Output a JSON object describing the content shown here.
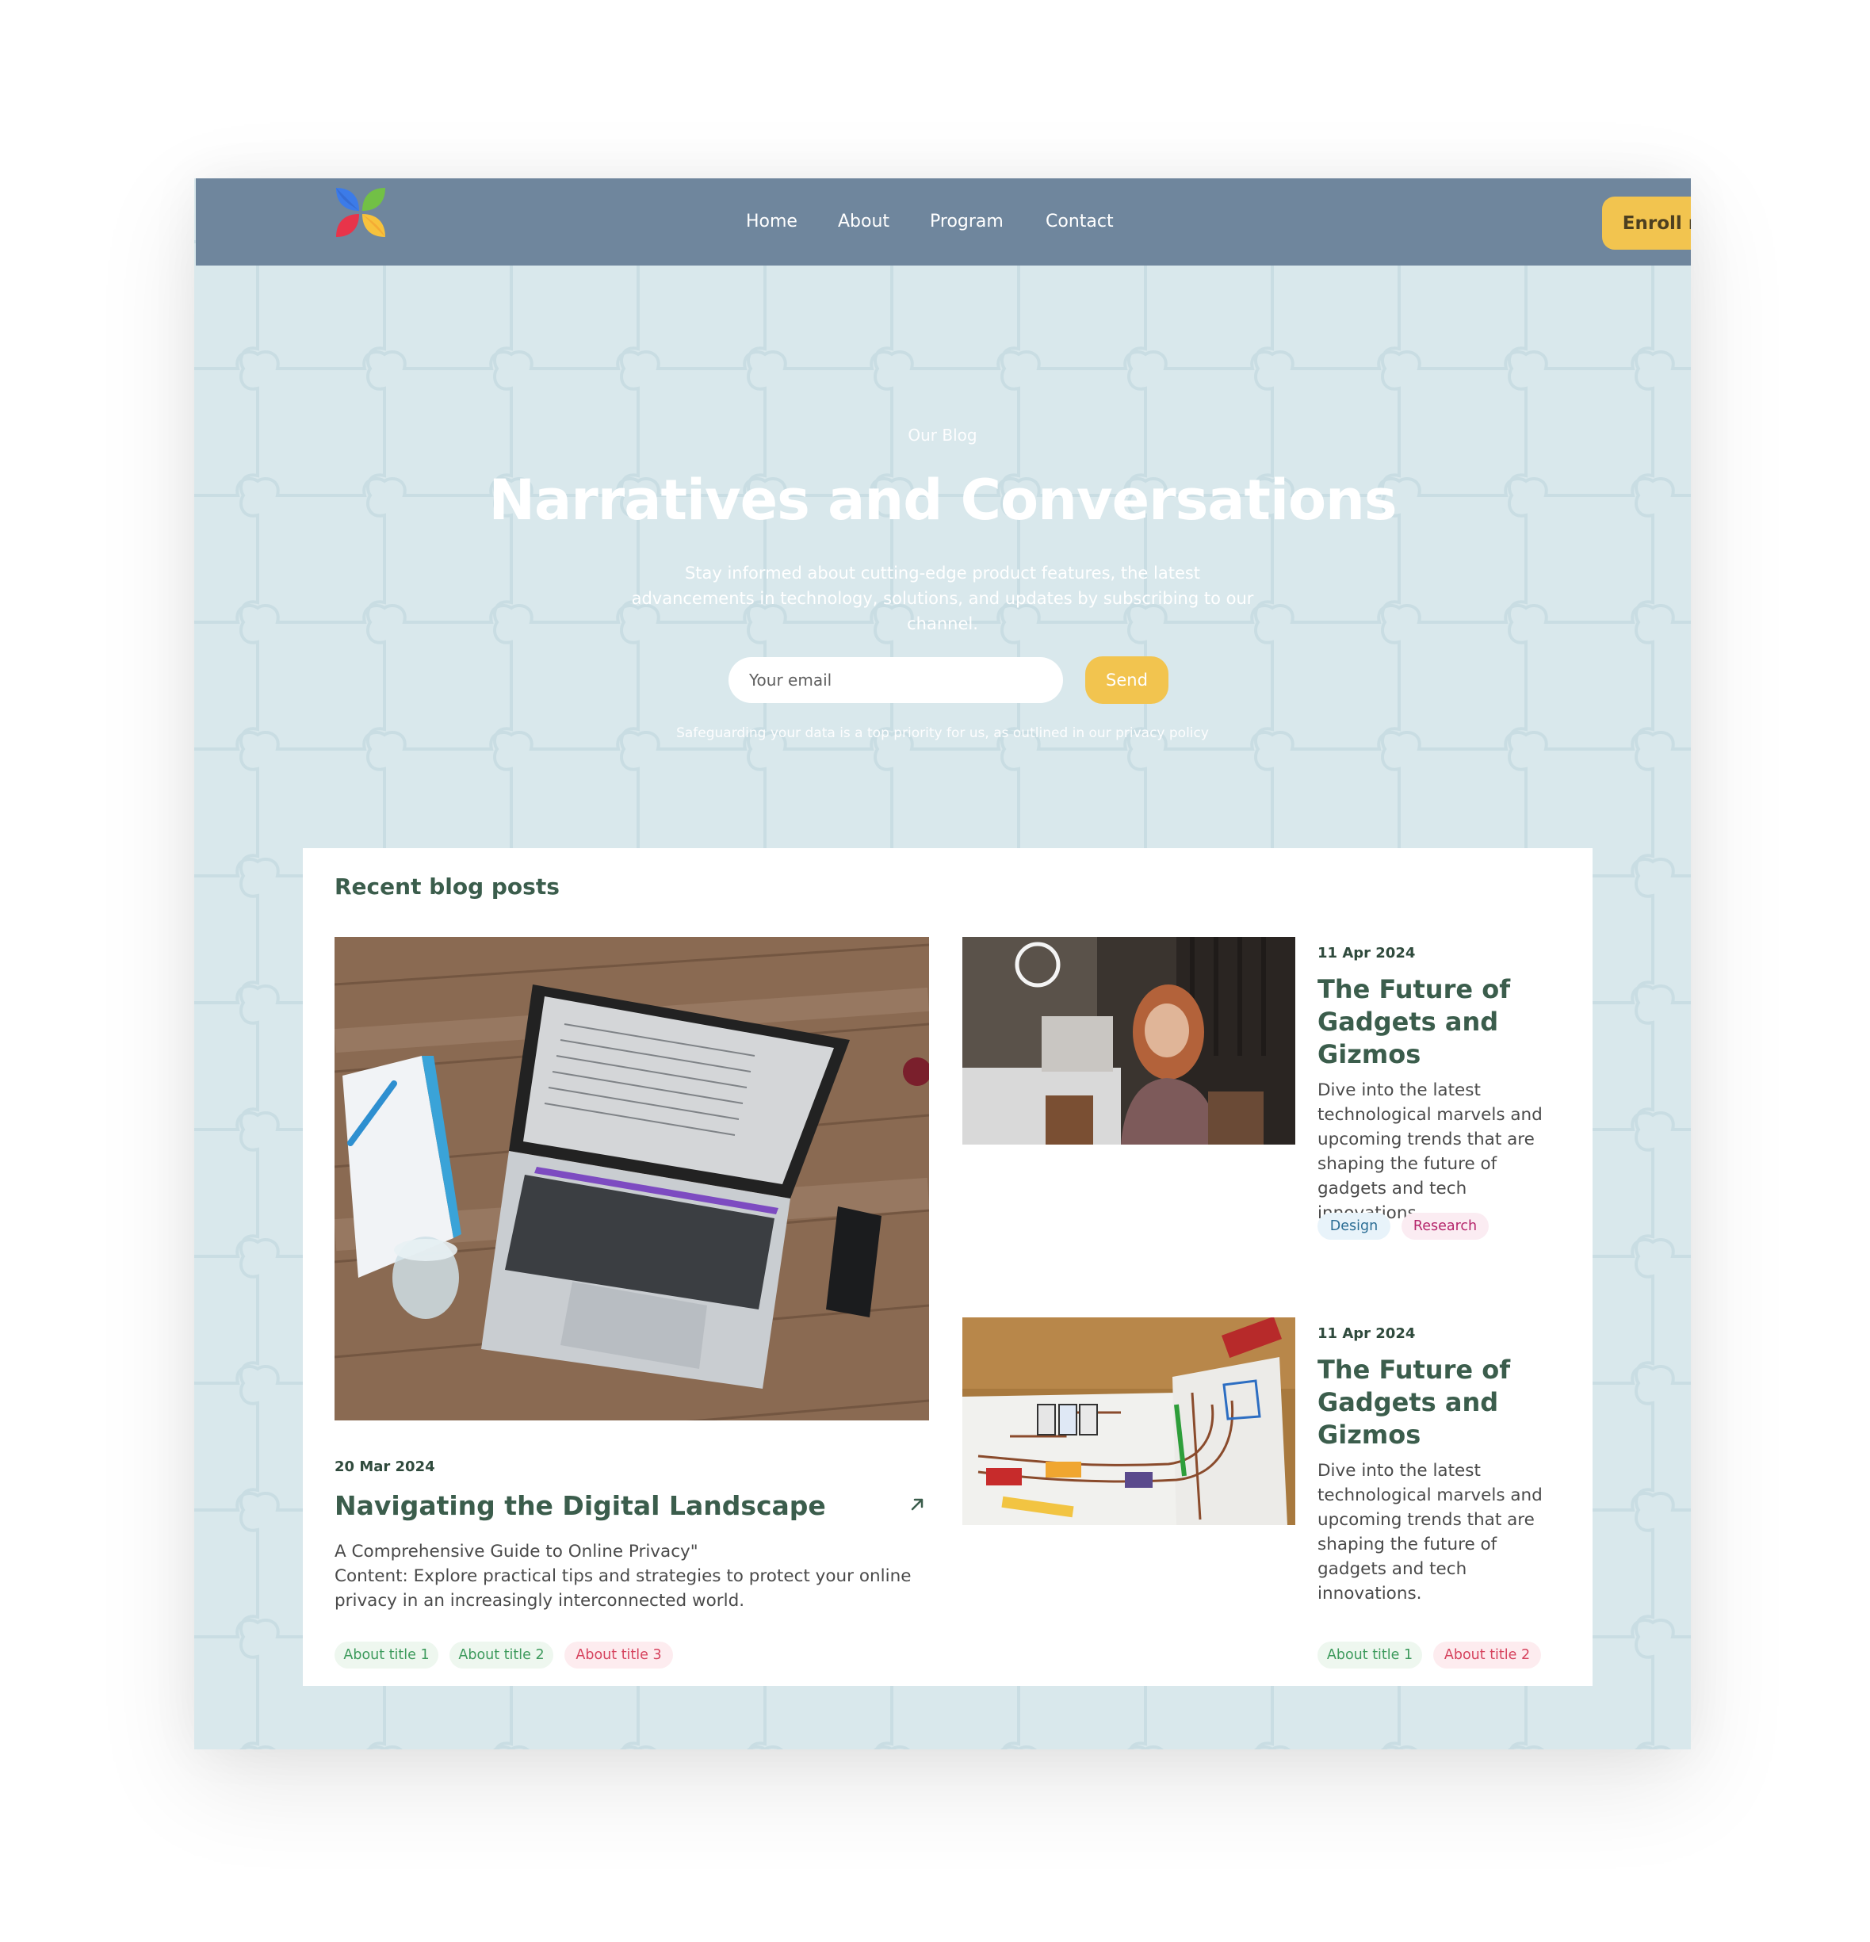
{
  "nav": {
    "links": [
      "Home",
      "About",
      "Program",
      "Contact"
    ],
    "enroll_label": "Enroll now"
  },
  "hero": {
    "kicker": "Our Blog",
    "title": "Narratives and Conversations",
    "subtitle": "Stay informed about cutting-edge product features, the latest advancements in technology, solutions, and updates by subscribing to our channel.",
    "email_placeholder": "Your email",
    "send_label": "Send",
    "privacy": "Safeguarding your data is a top priority for us, as outlined in our privacy policy"
  },
  "blog": {
    "section_title": "Recent blog posts",
    "featured": {
      "date": "20 Mar 2024",
      "title": "Navigating the Digital Landscape",
      "desc_line1": "A Comprehensive Guide to Online Privacy\"",
      "desc_line2": "Content: Explore practical tips and strategies to protect your online privacy in an increasingly interconnected world.",
      "tags": [
        "About title 1",
        "About title 2",
        "About title 3"
      ]
    },
    "posts": [
      {
        "date": "11 Apr 2024",
        "title": "The Future of Gadgets and Gizmos",
        "desc": "Dive into the latest technological marvels and upcoming trends that are shaping the future of gadgets and tech innovations.",
        "tags": [
          "Design",
          "Research"
        ]
      },
      {
        "date": "11 Apr 2024",
        "title": "The Future of Gadgets and Gizmos",
        "desc": "Dive into the latest technological marvels and upcoming trends that are shaping the future of gadgets and tech innovations.",
        "tags": [
          "About title 1",
          "About title 2"
        ]
      }
    ]
  },
  "colors": {
    "nav_bg": "#6f869d",
    "page_bg": "#d9e8ec",
    "accent_yellow": "#f2c44f",
    "heading_green": "#3b5d4c"
  }
}
